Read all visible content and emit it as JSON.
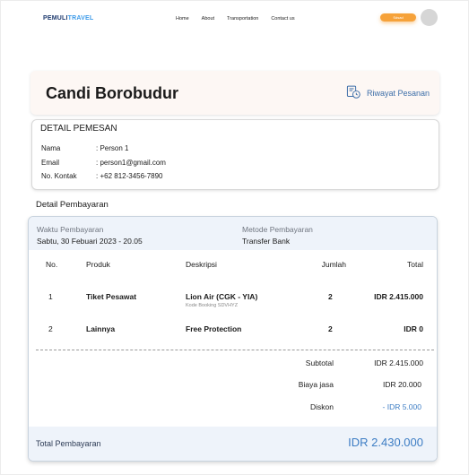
{
  "nav": {
    "logo_part1": "PEMULI",
    "logo_part2": "TRAVEL",
    "menu": [
      "Home",
      "About",
      "Transportation",
      "Contact us"
    ],
    "login_label": "Sdsad"
  },
  "header": {
    "title": "Candi Borobudur",
    "history_label": "Riwayat Pesanan"
  },
  "customer": {
    "heading": "DETAIL PEMESAN",
    "name_label": "Nama",
    "name_value": ": Person 1",
    "email_label": "Email",
    "email_value": ": person1@gmail.com",
    "contact_label": "No.  Kontak",
    "contact_value": ": +62 812-3456-7890"
  },
  "payment": {
    "section_label": "Detail Pembayaran",
    "time_label": "Waktu Pembayaran",
    "time_value": "Sabtu, 30 Febuari 2023 - 20.05",
    "method_label": "Metode Pembayaran",
    "method_value": "Transfer Bank",
    "columns": {
      "no": "No.",
      "product": "Produk",
      "desc": "Deskripsi",
      "qty": "Jumlah",
      "total": "Total"
    },
    "rows": [
      {
        "no": "1",
        "product": "Tiket Pesawat",
        "desc": "Lion Air (CGK - YIA)",
        "desc_sub": "Kode Booking SDVHYZ",
        "qty": "2",
        "total": "IDR 2.415.000"
      },
      {
        "no": "2",
        "product": "Lainnya",
        "desc": "Free Protection",
        "desc_sub": "",
        "qty": "2",
        "total": "IDR 0"
      }
    ],
    "subtotal_label": "Subtotal",
    "subtotal_value": "IDR 2.415.000",
    "fee_label": "Biaya jasa",
    "fee_value": "IDR 20.000",
    "discount_label": "Diskon",
    "discount_value": "- IDR  5.000",
    "grand_label": "Total Pembayaran",
    "grand_value": "IDR 2.430.000"
  },
  "colors": {
    "accent": "#3d7dc4",
    "login_button": "#f6a23a",
    "title_card_bg": "#fdf7f4",
    "panel_bg": "#eef3fa"
  }
}
